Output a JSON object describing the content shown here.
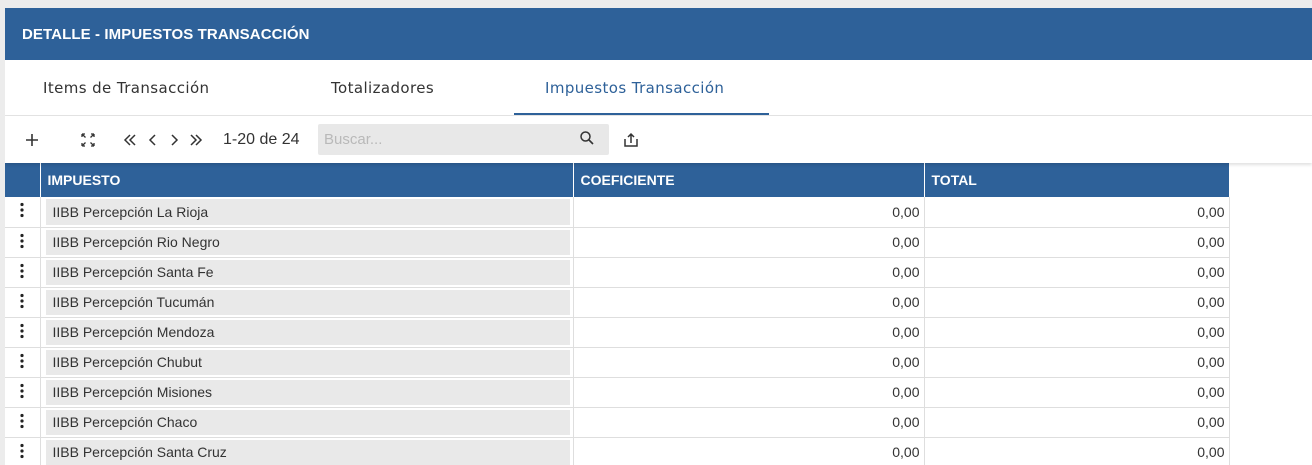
{
  "header": {
    "title": "DETALLE - IMPUESTOS TRANSACCIÓN"
  },
  "tabs": [
    {
      "label": "Items de Transacción",
      "active": false
    },
    {
      "label": "Totalizadores",
      "active": false
    },
    {
      "label": "Impuestos Transacción",
      "active": true
    }
  ],
  "toolbar": {
    "page_info": "1-20 de 24",
    "search_placeholder": "Buscar...",
    "icons": [
      "plus-icon",
      "expand-icon",
      "first-page-icon",
      "prev-page-icon",
      "next-page-icon",
      "last-page-icon",
      "search-icon",
      "export-icon"
    ]
  },
  "table": {
    "columns": [
      "IMPUESTO",
      "COEFICIENTE",
      "TOTAL"
    ],
    "rows": [
      {
        "impuesto": "IIBB Percepción La Rioja",
        "coeficiente": "0,00",
        "total": "0,00"
      },
      {
        "impuesto": "IIBB Percepción Rio Negro",
        "coeficiente": "0,00",
        "total": "0,00"
      },
      {
        "impuesto": "IIBB Percepción Santa Fe",
        "coeficiente": "0,00",
        "total": "0,00"
      },
      {
        "impuesto": "IIBB Percepción Tucumán",
        "coeficiente": "0,00",
        "total": "0,00"
      },
      {
        "impuesto": "IIBB Percepción Mendoza",
        "coeficiente": "0,00",
        "total": "0,00"
      },
      {
        "impuesto": "IIBB Percepción Chubut",
        "coeficiente": "0,00",
        "total": "0,00"
      },
      {
        "impuesto": "IIBB Percepción Misiones",
        "coeficiente": "0,00",
        "total": "0,00"
      },
      {
        "impuesto": "IIBB Percepción Chaco",
        "coeficiente": "0,00",
        "total": "0,00"
      },
      {
        "impuesto": "IIBB Percepción Santa Cruz",
        "coeficiente": "0,00",
        "total": "0,00"
      }
    ]
  },
  "colors": {
    "primary": "#2e6199",
    "cell_gray": "#e9e9e9",
    "background": "#ececec"
  }
}
